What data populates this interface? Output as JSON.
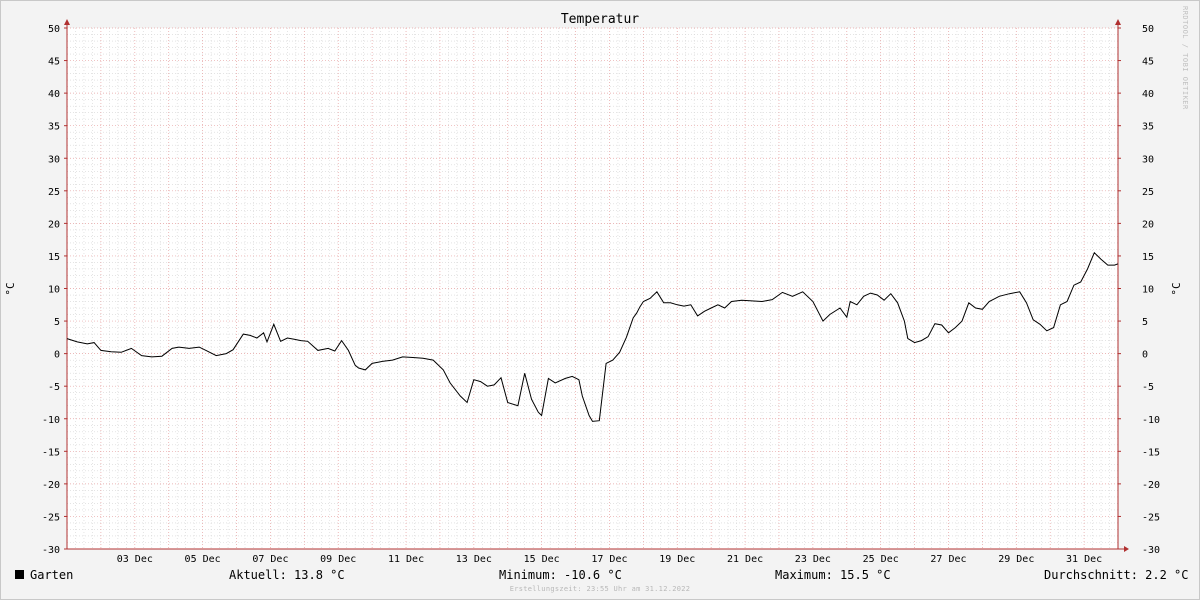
{
  "watermark": "RRDTOOL / TOBI OETIKER",
  "legend": {
    "series_name": "Garten",
    "current": "Aktuell: 13.8 °C",
    "minimum": "Minimum: -10.6 °C",
    "maximum": "Maximum: 15.5 °C",
    "average": "Durchschnitt: 2.2 °C"
  },
  "footer_note": "Erstellungszeit: 23:55 Uhr am 31.12.2022",
  "colors": {
    "background": "#f3f3f3",
    "plot_background": "#ffffff",
    "minor_grid": "#d4d4d4",
    "major_grid": "#e6a0a0",
    "axis": "#b03030",
    "series": "#000000"
  },
  "chart_data": {
    "type": "line",
    "title": "Temperatur",
    "ylabel": "°C",
    "ylabel_right": "°C",
    "ylim": [
      -30,
      50
    ],
    "yticks": [
      50,
      45,
      40,
      35,
      30,
      25,
      20,
      15,
      10,
      5,
      0,
      -5,
      -10,
      -15,
      -20,
      -25,
      -30
    ],
    "xlim": [
      1,
      32
    ],
    "xtick_labels": [
      "03 Dec",
      "05 Dec",
      "07 Dec",
      "09 Dec",
      "11 Dec",
      "13 Dec",
      "15 Dec",
      "17 Dec",
      "19 Dec",
      "21 Dec",
      "23 Dec",
      "25 Dec",
      "27 Dec",
      "29 Dec",
      "31 Dec"
    ],
    "xtick_days": [
      3,
      5,
      7,
      9,
      11,
      13,
      15,
      17,
      19,
      21,
      23,
      25,
      27,
      29,
      31
    ],
    "grid": true,
    "series": [
      {
        "name": "Garten",
        "x": [
          1,
          1.3,
          1.6,
          1.8,
          2.0,
          2.3,
          2.6,
          2.9,
          3.2,
          3.5,
          3.8,
          4.1,
          4.3,
          4.6,
          4.9,
          5.1,
          5.4,
          5.7,
          5.9,
          6.2,
          6.4,
          6.6,
          6.8,
          6.9,
          7.1,
          7.3,
          7.5,
          7.7,
          7.9,
          8.1,
          8.4,
          8.7,
          8.9,
          9.1,
          9.3,
          9.5,
          9.6,
          9.8,
          10.0,
          10.3,
          10.6,
          10.9,
          11.2,
          11.5,
          11.8,
          12.1,
          12.3,
          12.6,
          12.8,
          13.0,
          13.2,
          13.4,
          13.6,
          13.8,
          14.0,
          14.3,
          14.5,
          14.7,
          14.9,
          15.0,
          15.2,
          15.4,
          15.7,
          15.9,
          16.1,
          16.2,
          16.4,
          16.5,
          16.7,
          16.9,
          17.1,
          17.3,
          17.5,
          17.7,
          17.8,
          17.9,
          18.0,
          18.2,
          18.4,
          18.6,
          18.8,
          19.0,
          19.2,
          19.4,
          19.6,
          19.8,
          20.0,
          20.2,
          20.4,
          20.6,
          20.9,
          21.2,
          21.5,
          21.8,
          22.1,
          22.4,
          22.7,
          23.0,
          23.3,
          23.5,
          23.8,
          24.0,
          24.1,
          24.3,
          24.5,
          24.7,
          24.9,
          25.1,
          25.3,
          25.5,
          25.7,
          25.8,
          26.0,
          26.2,
          26.4,
          26.6,
          26.8,
          27.0,
          27.2,
          27.4,
          27.6,
          27.8,
          28.0,
          28.2,
          28.5,
          28.8,
          29.1,
          29.3,
          29.5,
          29.7,
          29.9,
          30.1,
          30.3,
          30.5,
          30.7,
          30.9,
          31.1,
          31.3,
          31.5,
          31.7,
          31.9,
          32.0
        ],
        "y": [
          2.3,
          1.8,
          1.5,
          1.7,
          0.5,
          0.3,
          0.2,
          0.8,
          -0.3,
          -0.5,
          -0.4,
          0.8,
          1.0,
          0.8,
          1.0,
          0.5,
          -0.3,
          0.0,
          0.6,
          3.0,
          2.8,
          2.4,
          3.2,
          1.8,
          4.5,
          1.9,
          2.4,
          2.2,
          2.0,
          1.9,
          0.5,
          0.8,
          0.4,
          2.0,
          0.5,
          -1.8,
          -2.2,
          -2.5,
          -1.5,
          -1.2,
          -1.0,
          -0.5,
          -0.6,
          -0.7,
          -1.0,
          -2.5,
          -4.5,
          -6.5,
          -7.5,
          -4.0,
          -4.3,
          -5.0,
          -4.8,
          -3.7,
          -7.5,
          -8.0,
          -3.0,
          -7.0,
          -9.0,
          -9.5,
          -3.8,
          -4.5,
          -3.8,
          -3.5,
          -4.0,
          -6.5,
          -9.5,
          -10.4,
          -10.3,
          -1.5,
          -1.0,
          0.2,
          2.5,
          5.5,
          6.2,
          7.2,
          8.0,
          8.5,
          9.5,
          7.8,
          7.8,
          7.5,
          7.3,
          7.5,
          5.8,
          6.5,
          7.0,
          7.5,
          7.0,
          8.0,
          8.2,
          8.1,
          8.0,
          8.3,
          9.4,
          8.8,
          9.5,
          8.0,
          5.0,
          6.0,
          7.0,
          5.6,
          8.0,
          7.5,
          8.8,
          9.3,
          9.0,
          8.2,
          9.2,
          7.8,
          5.0,
          2.3,
          1.7,
          2.0,
          2.6,
          4.6,
          4.4,
          3.2,
          4.0,
          5.0,
          7.8,
          7.0,
          6.8,
          8.0,
          8.8,
          9.2,
          9.5,
          7.8,
          5.2,
          4.5,
          3.5,
          4.0,
          7.5,
          8.0,
          10.5,
          11.0,
          13.0,
          15.5,
          14.5,
          13.6,
          13.6,
          13.8
        ]
      }
    ]
  }
}
